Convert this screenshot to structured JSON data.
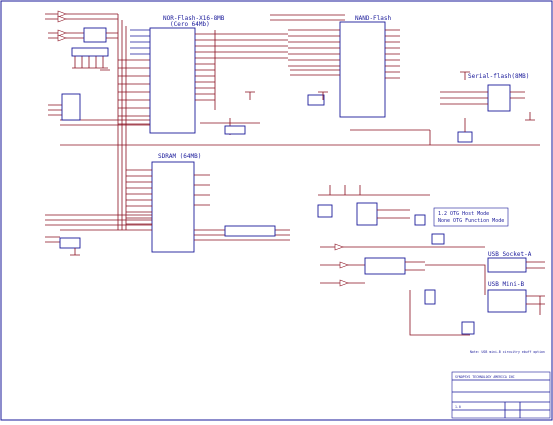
{
  "blocks": {
    "nor_flash": {
      "title": "NOR-Flash-X16-8MB",
      "subtitle": "(Cero 64Mb)"
    },
    "nand_flash": {
      "title": "NAND-Flash"
    },
    "serial_flash": {
      "title": "Serial-flash(8MB)"
    },
    "sdram": {
      "title": "SDRAM (64MB)"
    },
    "usb_socket_a": {
      "title": "USB Socket-A"
    },
    "usb_mini_b": {
      "title": "USB Mini-B"
    }
  },
  "notes": {
    "usb_mode_line1": "1.2 OTG Host Mode",
    "usb_mode_line2": "None OTG Function Mode",
    "usb_footnote": "Note: USB mini-B circuitry ebuff option"
  },
  "title_block": {
    "company": "SYNOPSYS TECHNOLOGY AMERICA INC",
    "rev": "1.0"
  }
}
